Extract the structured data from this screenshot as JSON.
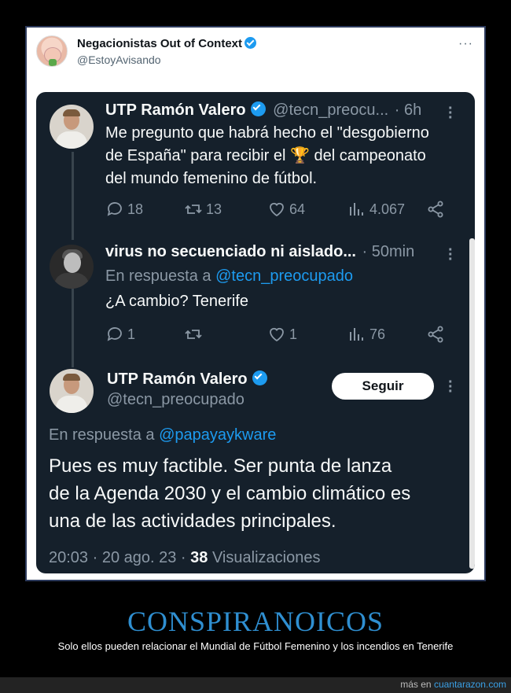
{
  "outer_tweet": {
    "name": "Negacionistas Out of Context",
    "handle": "@EstoyAvisando",
    "more": "···"
  },
  "tweet1": {
    "name": "UTP Ramón Valero",
    "handle": "@tecn_preocu...",
    "time": "· 6h",
    "text_line1": "Me pregunto que habrá hecho el \"desgobierno",
    "text_line2_a": "de España\" para recibir el",
    "trophy": "🏆",
    "text_line2_b": "del campeonato",
    "text_line3": "del mundo femenino de fútbol.",
    "replies": "18",
    "retweets": "13",
    "likes": "64",
    "views": "4.067"
  },
  "tweet2": {
    "name": "virus no secuenciado ni aislado...",
    "time": "· 50min",
    "reply_prefix": "En respuesta a",
    "reply_to": "@tecn_preocupado",
    "text": "¿A cambio? Tenerife",
    "replies": "1",
    "retweets": "",
    "likes": "1",
    "views": "76"
  },
  "tweet3": {
    "name": "UTP Ramón Valero",
    "handle": "@tecn_preocupado",
    "follow_label": "Seguir",
    "reply_prefix": "En respuesta a",
    "reply_to": "@papayaykware",
    "text_line1": "Pues es muy factible. Ser punta de lanza",
    "text_line2": "de la Agenda 2030 y el cambio climático es",
    "text_line3": "una de las actividades principales.",
    "timestamp": "20:03 · 20 ago. 23 ·",
    "views_count": "38",
    "views_label": "Visualizaciones"
  },
  "caption": {
    "title": "CONSPIRANOICOS",
    "subtitle": "Solo ellos pueden relacionar el Mundial de Fútbol Femenino y los incendios en Tenerife"
  },
  "footer": {
    "prefix": "más en",
    "site": "cuantarazon.com"
  },
  "colors": {
    "card_bg": "#15202b",
    "accent": "#1d9bf0",
    "caption_title": "#2f8fd1"
  }
}
